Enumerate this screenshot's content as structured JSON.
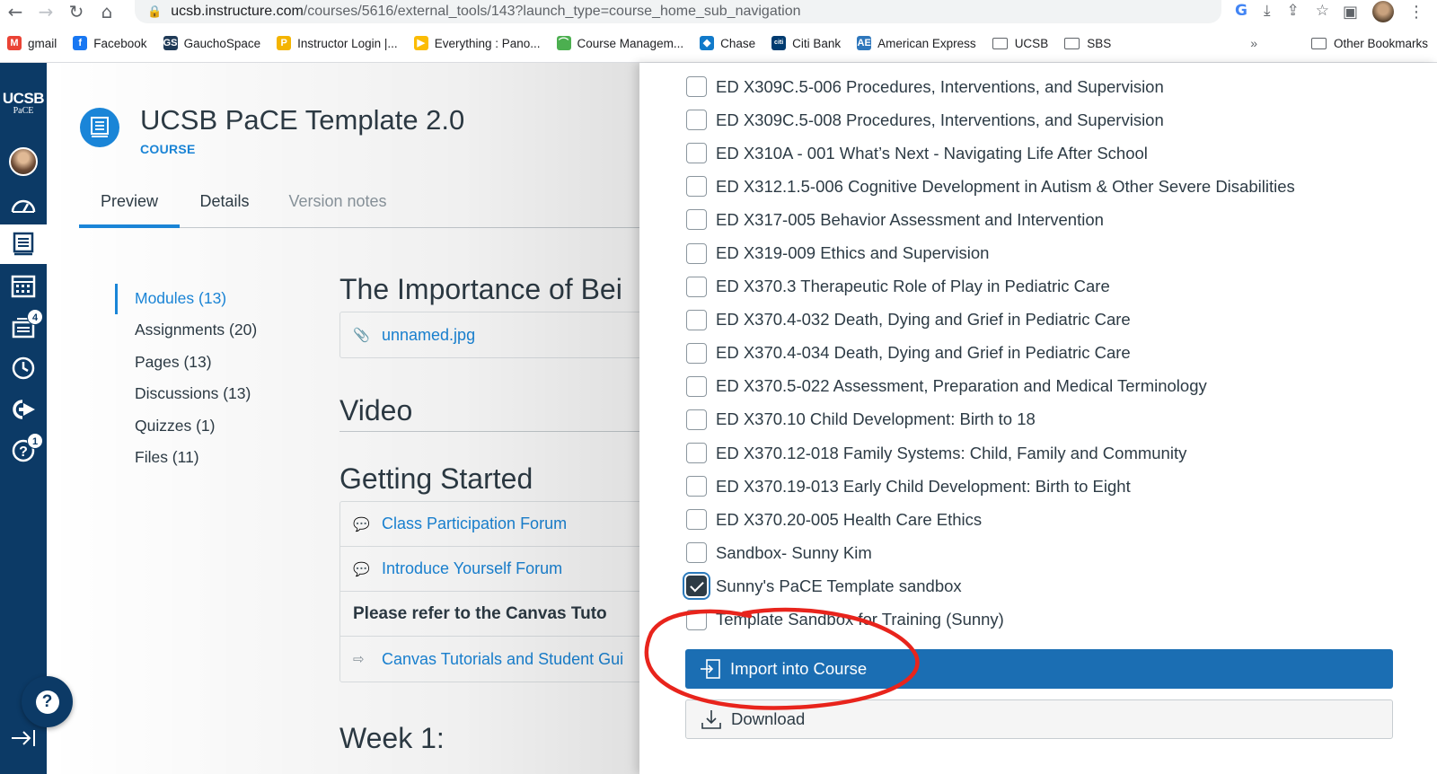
{
  "browser": {
    "url_host": "ucsb.instructure.com",
    "url_path": "/courses/5616/external_tools/143?launch_type=course_home_sub_navigation",
    "bookmarks": [
      {
        "label": "gmail",
        "color": "#ea4335",
        "glyph": "M"
      },
      {
        "label": "Facebook",
        "color": "#1877f2",
        "glyph": "f"
      },
      {
        "label": "GauchoSpace",
        "color": "#1f3a57",
        "glyph": "GS"
      },
      {
        "label": "Instructor Login |...",
        "color": "#f4b400",
        "glyph": "P"
      },
      {
        "label": "Everything : Pano...",
        "color": "#fbbc05",
        "glyph": "▶"
      },
      {
        "label": "Course Managem...",
        "color": "#4caf50",
        "glyph": "⌒"
      },
      {
        "label": "Chase",
        "color": "#117aca",
        "glyph": "◆"
      },
      {
        "label": "Citi Bank",
        "color": "#003b70",
        "glyph": "citi"
      },
      {
        "label": "American Express",
        "color": "#2e77bc",
        "glyph": "AE"
      }
    ],
    "bookmark_folders": [
      "UCSB",
      "SBS"
    ],
    "more_label": "»",
    "other_bookmarks": "Other Bookmarks"
  },
  "global_nav": {
    "logo_line1": "UCSB",
    "logo_line2": "PaCE",
    "inbox_badge": "4",
    "help_badge": "1"
  },
  "course": {
    "title": "UCSB PaCE Template 2.0",
    "subtitle": "COURSE",
    "tabs": [
      "Preview",
      "Details",
      "Version notes"
    ],
    "side_items": [
      "Modules (13)",
      "Assignments (20)",
      "Pages (13)",
      "Discussions (13)",
      "Quizzes (1)",
      "Files (11)"
    ],
    "section1": "The Importance of Bei",
    "attachment": "unnamed.jpg",
    "section2": "Video",
    "section3": "Getting Started",
    "links": [
      "Class Participation Forum",
      "Introduce Yourself Forum"
    ],
    "bold_row": "Please refer to the Canvas Tuto",
    "link3": "Canvas Tutorials and Student Gui",
    "section4": "Week 1:"
  },
  "tray": {
    "courses": [
      {
        "label": "ED X309C.5-006 Procedures, Interventions, and Supervision",
        "checked": false
      },
      {
        "label": "ED X309C.5-008 Procedures, Interventions, and Supervision",
        "checked": false
      },
      {
        "label": "ED X310A - 001 What’s Next - Navigating Life After School",
        "checked": false
      },
      {
        "label": "ED X312.1.5-006 Cognitive Development in Autism & Other Severe Disabilities",
        "checked": false
      },
      {
        "label": "ED X317-005 Behavior Assessment and Intervention",
        "checked": false
      },
      {
        "label": "ED X319-009 Ethics and Supervision",
        "checked": false
      },
      {
        "label": "ED X370.3 Therapeutic Role of Play in Pediatric Care",
        "checked": false
      },
      {
        "label": "ED X370.4-032 Death, Dying and Grief in Pediatric Care",
        "checked": false
      },
      {
        "label": "ED X370.4-034 Death, Dying and Grief in Pediatric Care",
        "checked": false
      },
      {
        "label": "ED X370.5-022 Assessment, Preparation and Medical Terminology",
        "checked": false
      },
      {
        "label": "ED X370.10 Child Development: Birth to 18",
        "checked": false
      },
      {
        "label": "ED X370.12-018 Family Systems: Child, Family and Community",
        "checked": false
      },
      {
        "label": "ED X370.19-013 Early Child Development: Birth to Eight",
        "checked": false
      },
      {
        "label": "ED X370.20-005 Health Care Ethics",
        "checked": false
      },
      {
        "label": "Sandbox- Sunny Kim",
        "checked": false
      },
      {
        "label": "Sunny's PaCE Template sandbox",
        "checked": true
      },
      {
        "label": "Template Sandbox for Training (Sunny)",
        "checked": false
      }
    ],
    "import_label": "Import into Course",
    "download_label": "Download"
  },
  "colors": {
    "canvas_nav": "#0c3a66",
    "link_blue": "#1a86d9",
    "primary_button": "#1b6eb3",
    "annotation_red": "#e8241c"
  }
}
